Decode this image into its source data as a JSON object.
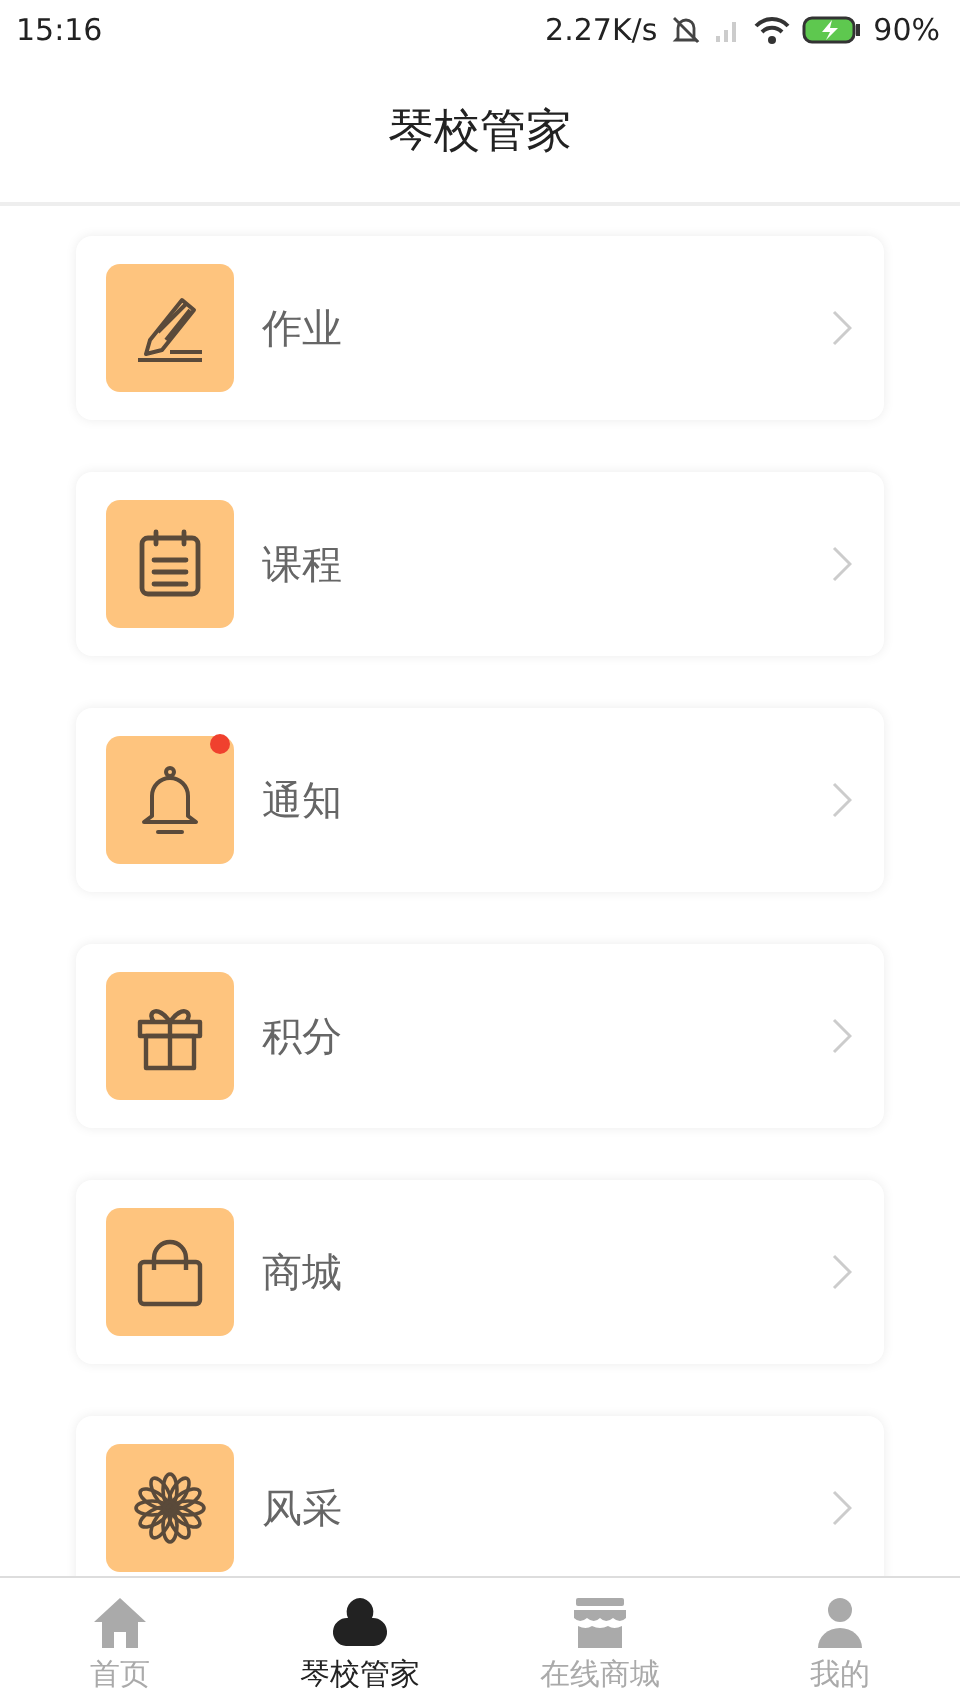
{
  "status_bar": {
    "time": "15:16",
    "speed": "2.27K/s",
    "battery": "90%"
  },
  "header": {
    "title": "琴校管家"
  },
  "items": [
    {
      "label": "作业",
      "kind": "pencil",
      "badge": false
    },
    {
      "label": "课程",
      "kind": "calendar",
      "badge": false
    },
    {
      "label": "通知",
      "kind": "bell",
      "badge": true
    },
    {
      "label": "积分",
      "kind": "gift",
      "badge": false
    },
    {
      "label": "商城",
      "kind": "bag",
      "badge": false
    },
    {
      "label": "风采",
      "kind": "flower",
      "badge": false
    }
  ],
  "tabs": [
    {
      "label": "首页",
      "kind": "home",
      "selected": false
    },
    {
      "label": "琴校管家",
      "kind": "cloud",
      "selected": true
    },
    {
      "label": "在线商城",
      "kind": "store",
      "selected": false
    },
    {
      "label": "我的",
      "kind": "person",
      "selected": false
    }
  ]
}
